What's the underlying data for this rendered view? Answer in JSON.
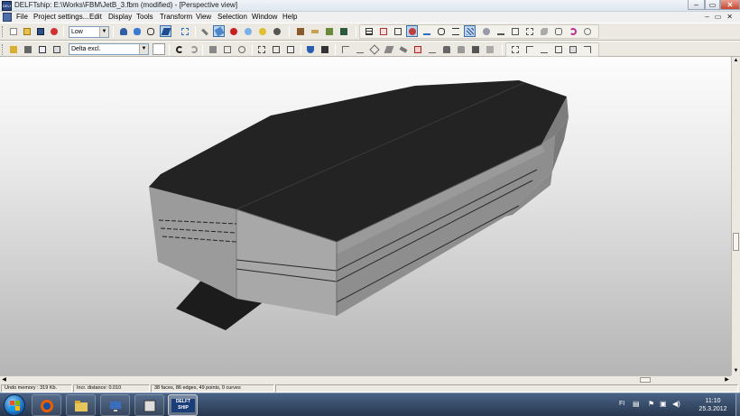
{
  "window": {
    "title": "DELFTship: E:\\Works\\FBM\\JetB_3.fbm (modified) - [Perspective view]",
    "app_logo_text": "DELFT"
  },
  "menu": {
    "items": [
      "File",
      "Project settings...",
      "Edit",
      "Display",
      "Tools",
      "Transform",
      "View",
      "Selection",
      "Window",
      "Help"
    ]
  },
  "toolbar": {
    "precision_value": "Low",
    "layer_value": "Delta excl."
  },
  "status": {
    "undo_memory": "Undo memory : 319 Kb.",
    "incr_distance": "Incr. distance: 0.010",
    "model_info": "38 faces, 86 edges, 49 points, 0 curves"
  },
  "taskbar": {
    "delftship_button": "DELFT SHIP",
    "tray_lang": "FI",
    "time": "11:10",
    "date": "25.3.2012"
  },
  "colors": {
    "deck": "#232323",
    "hull_side": "#8d8d8d",
    "hull_light": "#a3a3a3",
    "accent": "#3a6ea5"
  }
}
